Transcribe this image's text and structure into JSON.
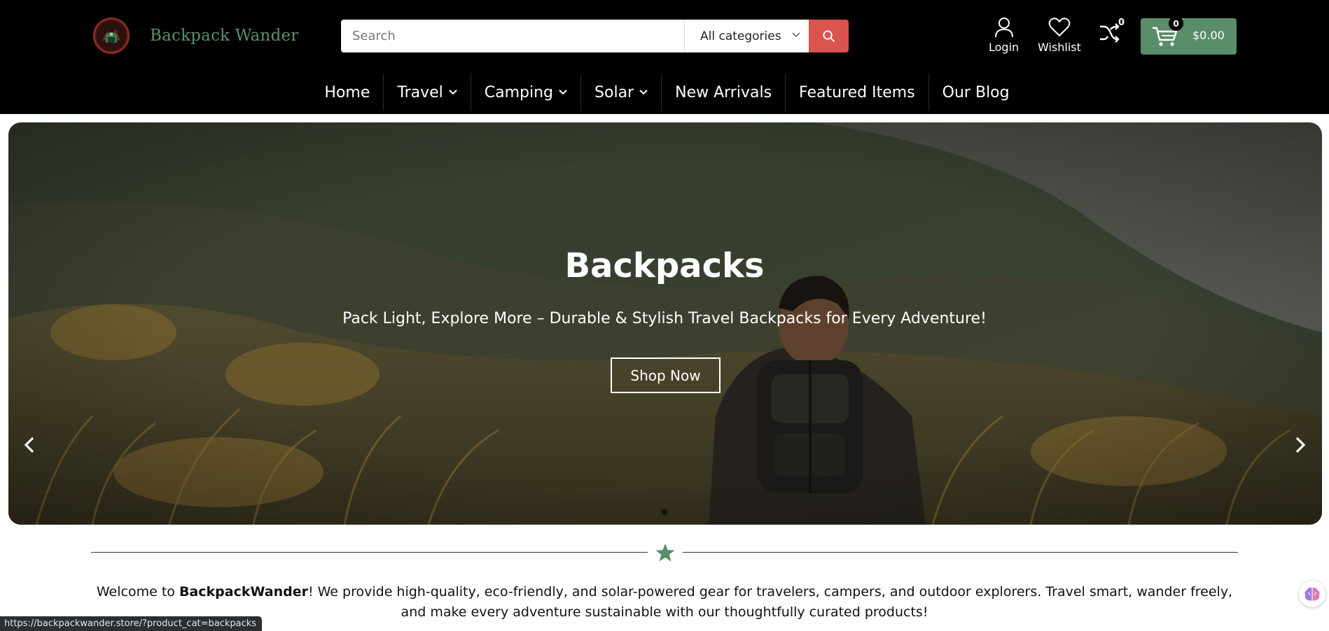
{
  "header": {
    "brand": "Backpack Wander",
    "logo_icon": "backpack-logo-icon",
    "search": {
      "placeholder": "Search",
      "value": "",
      "category": "All categories"
    },
    "login_label": "Login",
    "wishlist_label": "Wishlist",
    "compare_count": "0",
    "cart_count": "0",
    "cart_total": "$0.00"
  },
  "nav": {
    "items": [
      {
        "label": "Home",
        "dropdown": false
      },
      {
        "label": "Travel",
        "dropdown": true
      },
      {
        "label": "Camping",
        "dropdown": true
      },
      {
        "label": "Solar",
        "dropdown": true
      },
      {
        "label": "New Arrivals",
        "dropdown": false
      },
      {
        "label": "Featured Items",
        "dropdown": false
      },
      {
        "label": "Our Blog",
        "dropdown": false
      }
    ]
  },
  "hero": {
    "title": "Backpacks",
    "subtitle": "Pack Light, Explore More – Durable & Stylish Travel Backpacks for Every Adventure!",
    "button": "Shop Now",
    "slides_total": 1
  },
  "welcome": {
    "prefix": "Welcome to ",
    "brand": "BackpackWander",
    "suffix": "! We provide high-quality, eco-friendly, and solar-powered gear for travelers, campers, and outdoor explorers. Travel smart, wander freely, and make every adventure sustainable with our thoughtfully curated products!"
  },
  "status_bar": {
    "url": "https://backpackwander.store/?product_cat=backpacks"
  },
  "colors": {
    "accent_green": "#5a8d6a",
    "search_red": "#d9534f",
    "header_bg": "#000000"
  }
}
